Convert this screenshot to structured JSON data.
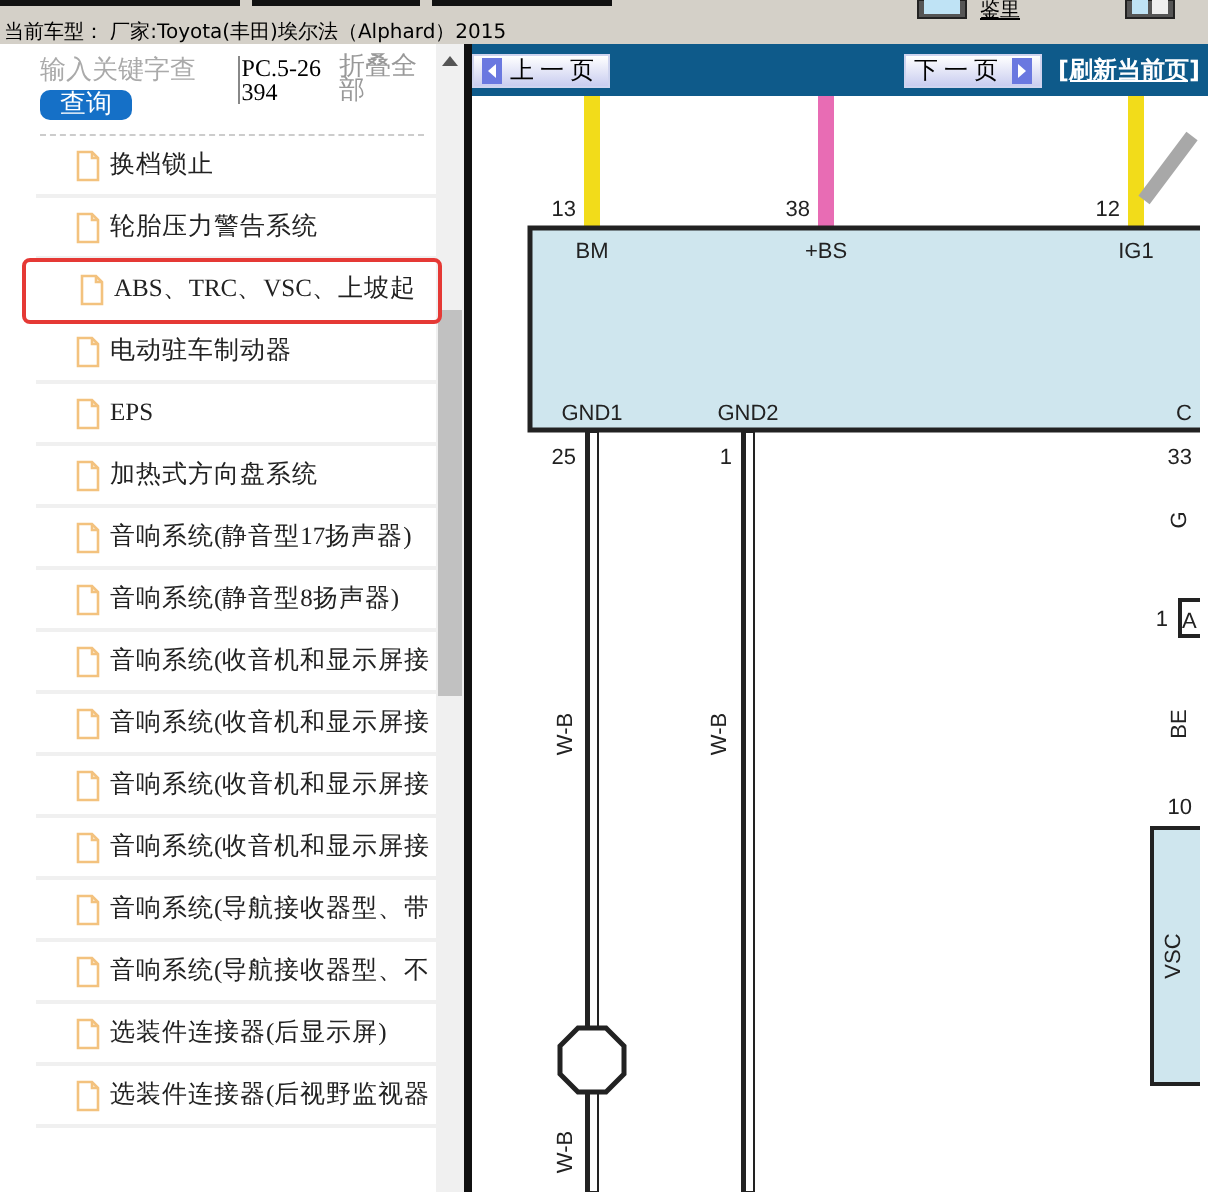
{
  "toolbar": {
    "label": "鉴里"
  },
  "vehicle": "当前车型： 厂家:Toyota(丰田)埃尔法（Alphard）2015",
  "sidebar": {
    "search": {
      "placeholder": "输入关键字查"
    },
    "search_button": "查询",
    "code": "PC.5-26394",
    "collapse": "折叠全部",
    "items": [
      {
        "label": "换档锁止",
        "selected": false
      },
      {
        "label": "轮胎压力警告系统",
        "selected": false
      },
      {
        "label": "ABS、TRC、VSC、上坡起",
        "selected": true
      },
      {
        "label": "电动驻车制动器",
        "selected": false
      },
      {
        "label": "EPS",
        "selected": false
      },
      {
        "label": "加热式方向盘系统",
        "selected": false
      },
      {
        "label": "音响系统(静音型17扬声器)",
        "selected": false
      },
      {
        "label": "音响系统(静音型8扬声器)",
        "selected": false
      },
      {
        "label": "音响系统(收音机和显示屏接",
        "selected": false
      },
      {
        "label": "音响系统(收音机和显示屏接",
        "selected": false
      },
      {
        "label": "音响系统(收音机和显示屏接",
        "selected": false
      },
      {
        "label": "音响系统(收音机和显示屏接",
        "selected": false
      },
      {
        "label": "音响系统(导航接收器型、带",
        "selected": false
      },
      {
        "label": "音响系统(导航接收器型、不",
        "selected": false
      },
      {
        "label": "选装件连接器(后显示屏)",
        "selected": false
      },
      {
        "label": "选装件连接器(后视野监视器",
        "selected": false
      }
    ]
  },
  "viewer": {
    "prev_button": "上一页",
    "next_button": "下一页",
    "refresh_link": "[刷新当前页]",
    "diagram": {
      "pins_top": [
        {
          "number": "13",
          "label": "BM",
          "color": "#f2dc1a"
        },
        {
          "number": "38",
          "label": "+BS",
          "color": "#e86cb4"
        },
        {
          "number": "12",
          "label": "IG1",
          "color": "#f2dc1a"
        }
      ],
      "pins_bottom": [
        {
          "number": "25",
          "label": "GND1"
        },
        {
          "number": "1",
          "label": "GND2"
        },
        {
          "number": "33",
          "label": "C"
        }
      ],
      "wire_labels": [
        "W-B",
        "W-B",
        "W-B"
      ],
      "side_labels": [
        "G",
        "BE"
      ],
      "connector": {
        "number": "1",
        "label": "A"
      },
      "module": {
        "number": "10",
        "label": "VSC"
      }
    }
  }
}
